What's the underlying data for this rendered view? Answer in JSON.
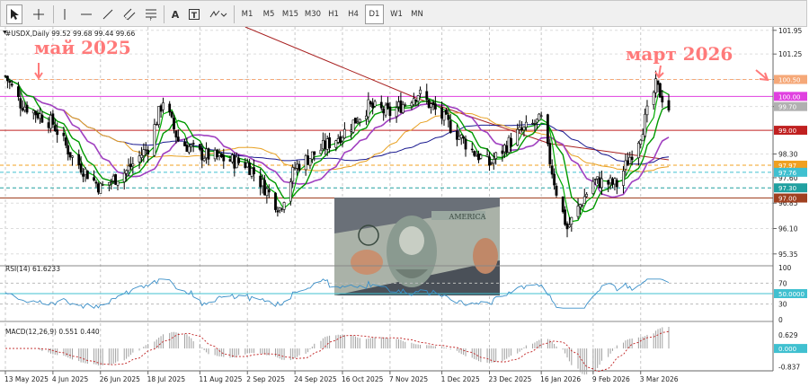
{
  "toolbar": {
    "timeframes": [
      "M1",
      "M5",
      "M15",
      "M30",
      "H1",
      "H4",
      "D1",
      "W1",
      "MN"
    ],
    "active_timeframe": "D1",
    "text_tool": "A"
  },
  "main_chart": {
    "header": "#USDX,Daily  99.52 99.68 99.44 99.66",
    "price_axis": [
      "101.95",
      "101.25",
      "100.50",
      "99.70",
      "98.30",
      "97.60",
      "96.85",
      "96.10",
      "95.35"
    ],
    "price_tags": [
      {
        "value": "100.50",
        "color": "#f5a878"
      },
      {
        "value": "100.00",
        "color": "#e040e0"
      },
      {
        "value": "99.70",
        "color": "#b0b0b0"
      },
      {
        "value": "99.00",
        "color": "#c02020"
      },
      {
        "value": "97.97",
        "color": "#f0a020"
      },
      {
        "value": "97.76",
        "color": "#40c0d0"
      },
      {
        "value": "97.30",
        "color": "#20a0a0"
      },
      {
        "value": "97.00",
        "color": "#a04020"
      }
    ],
    "horizontal_lines": [
      100.5,
      100.0,
      99.0,
      97.97,
      97.76,
      97.3,
      97.0
    ],
    "annotations": {
      "left": "май 2025",
      "right": "март 2026"
    }
  },
  "rsi": {
    "header": "RSI(14) 61.6233",
    "axis": [
      "100",
      "70",
      "50.0000",
      "30",
      "0"
    ],
    "levels": [
      70,
      50,
      30
    ]
  },
  "macd": {
    "header": "MACD(12,26,9) 0.551 0.440",
    "axis": [
      "0.629",
      "0.000",
      "-0.837"
    ]
  },
  "dates": [
    "13 May 2025",
    "4 Jun 2025",
    "26 Jun 2025",
    "18 Jul 2025",
    "11 Aug 2025",
    "2 Sep 2025",
    "24 Sep 2025",
    "16 Oct 2025",
    "7 Nov 2025",
    "1 Dec 2025",
    "23 Dec 2025",
    "16 Jan 2026",
    "9 Feb 2026",
    "3 Mar 2026"
  ],
  "colors": {
    "bull": "#000000",
    "ma_fast": "#00aa00",
    "ma_mid": "#009900",
    "ma_purple": "#a040c0",
    "ma_orange": "#e8a020",
    "ma_blue": "#1a1a90",
    "ma_red": "#a82020",
    "annotation": "#ff7a7a"
  },
  "chart_data": {
    "type": "candlestick",
    "symbol": "#USDX",
    "timeframe": "Daily",
    "ohlc_last": {
      "open": 99.52,
      "high": 99.68,
      "low": 99.44,
      "close": 99.66
    },
    "close_path": [
      {
        "date": "2025-05-13",
        "close": 100.6
      },
      {
        "date": "2025-05-20",
        "close": 99.8
      },
      {
        "date": "2025-06-04",
        "close": 99.2
      },
      {
        "date": "2025-06-13",
        "close": 98.2
      },
      {
        "date": "2025-06-26",
        "close": 97.3
      },
      {
        "date": "2025-07-08",
        "close": 97.8
      },
      {
        "date": "2025-07-18",
        "close": 98.5
      },
      {
        "date": "2025-07-25",
        "close": 99.9
      },
      {
        "date": "2025-08-01",
        "close": 98.7
      },
      {
        "date": "2025-08-11",
        "close": 98.3
      },
      {
        "date": "2025-09-02",
        "close": 98.0
      },
      {
        "date": "2025-09-17",
        "close": 96.7
      },
      {
        "date": "2025-09-24",
        "close": 97.9
      },
      {
        "date": "2025-10-16",
        "close": 98.9
      },
      {
        "date": "2025-10-28",
        "close": 99.7
      },
      {
        "date": "2025-11-07",
        "close": 99.5
      },
      {
        "date": "2025-11-20",
        "close": 100.1
      },
      {
        "date": "2025-12-01",
        "close": 99.4
      },
      {
        "date": "2025-12-15",
        "close": 98.4
      },
      {
        "date": "2025-12-23",
        "close": 98.0
      },
      {
        "date": "2026-01-05",
        "close": 98.9
      },
      {
        "date": "2026-01-16",
        "close": 99.3
      },
      {
        "date": "2026-01-23",
        "close": 97.2
      },
      {
        "date": "2026-01-28",
        "close": 96.1
      },
      {
        "date": "2026-02-09",
        "close": 97.5
      },
      {
        "date": "2026-02-20",
        "close": 97.4
      },
      {
        "date": "2026-03-03",
        "close": 98.9
      },
      {
        "date": "2026-03-10",
        "close": 100.3
      },
      {
        "date": "2026-03-16",
        "close": 99.66
      }
    ]
  }
}
